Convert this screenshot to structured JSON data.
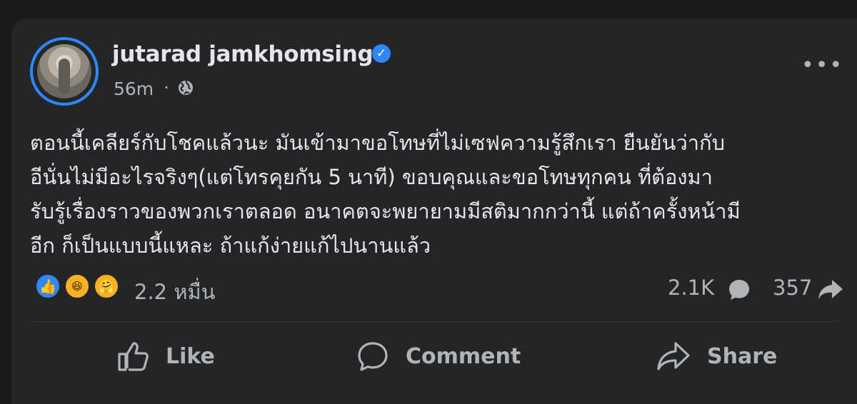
{
  "post": {
    "author": "jutarad jamkhomsing",
    "time": "56m",
    "separator": "·",
    "text_lines": [
      "ตอนนี้เคลียร์กับโชคแล้วนะ มันเข้ามาขอโทษที่ไม่เซฟความรู้สึกเรา ยืนยันว่ากับ",
      "อีนั่นไม่มีอะไรจริงๆ(แต่โทรคุยกัน 5 นาที) ขอบคุณและขอโทษทุกคน ที่ต้องมา",
      "รับรู้เรื่องราวของพวกเราตลอด อนาคตจะพยายามมีสติมากกว่านี้ แต่ถ้าครั้งหน้ามี",
      "อีก ก็เป็นแบบนี้แหละ ถ้าแก้ง่ายแก้ไปนานแล้ว"
    ]
  },
  "stats": {
    "reactions_count": "2.2 หมื่น",
    "comments_count": "2.1K",
    "shares_count": "357"
  },
  "actions": {
    "like": "Like",
    "comment": "Comment",
    "share": "Share"
  },
  "icons": {
    "verified": "verified-badge-icon",
    "privacy": "globe-icon",
    "more": "more-options-icon"
  },
  "colors": {
    "background": "#18191a",
    "card": "#242526",
    "accent": "#2d88ff",
    "text": "#e4e6eb",
    "muted": "#b0b3b8"
  }
}
